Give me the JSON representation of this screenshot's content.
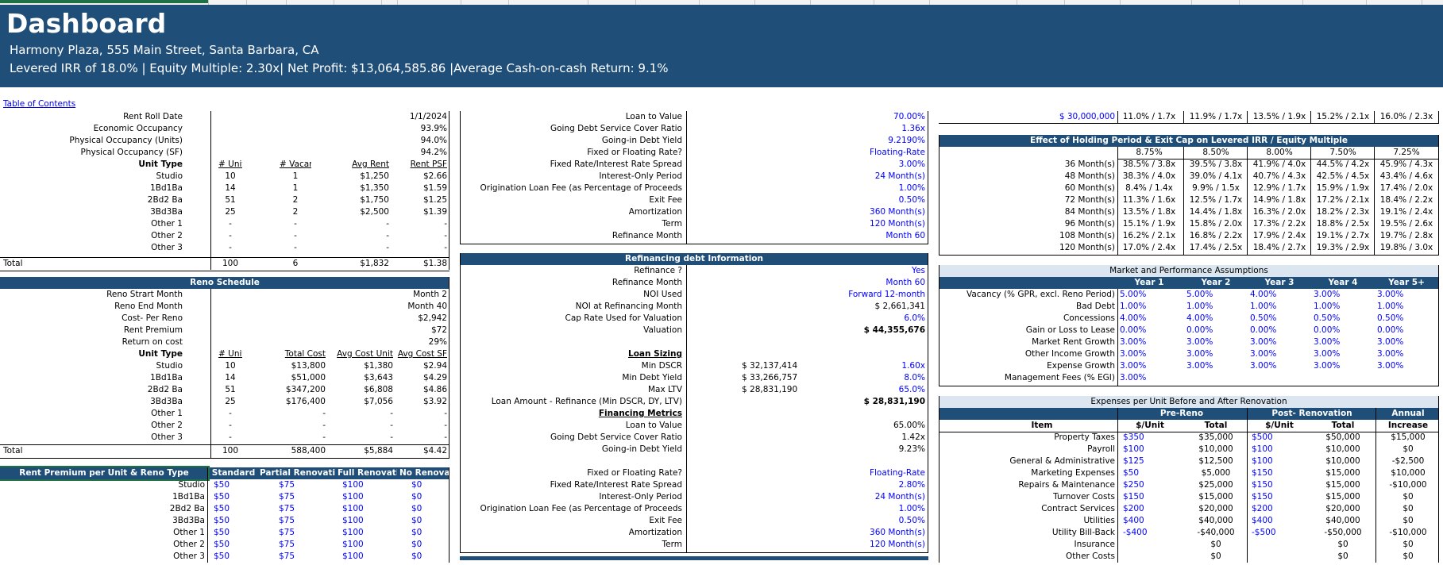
{
  "dashboard": {
    "title": "Dashboard",
    "address": "Harmony Plaza, 555 Main Street, Santa Barbara, CA",
    "summary": "Levered IRR of 18.0% | Equity Multiple: 2.30x| Net Profit: $13,064,585.86 |Average Cash-on-cash Return: 9.1%",
    "toc": "Table of Contents"
  },
  "colors": {
    "header_blue": "#1f4e79",
    "light_blue": "#dce6f1",
    "input_blue": "#0000ff"
  },
  "rent_roll": {
    "kv": [
      [
        "Rent Roll Date",
        "1/1/2024"
      ],
      [
        "Economic Occupancy",
        "93.9%"
      ],
      [
        "Physical Occupancy (Units)",
        "94.0%"
      ],
      [
        "Physical Occupancy (SF)",
        "94.2%"
      ]
    ],
    "headers": [
      "Unit Type",
      "# Units",
      "# Vacant",
      "Avg Rent",
      "Rent PSF"
    ],
    "rows": [
      [
        "Studio",
        "10",
        "1",
        "$1,250",
        "$2.66"
      ],
      [
        "1Bd1Ba",
        "14",
        "1",
        "$1,350",
        "$1.59"
      ],
      [
        "2Bd2 Ba",
        "51",
        "2",
        "$1,750",
        "$1.25"
      ],
      [
        "3Bd3Ba",
        "25",
        "2",
        "$2,500",
        "$1.39"
      ],
      [
        "Other 1",
        "-",
        "-",
        "-",
        "-"
      ],
      [
        "Other 2",
        "-",
        "-",
        "-",
        "-"
      ],
      [
        "Other 3",
        "-",
        "-",
        "-",
        "-"
      ]
    ],
    "total": [
      "Total",
      "100",
      "6",
      "$1,832",
      "$1.38"
    ]
  },
  "reno": {
    "title": "Reno Schedule",
    "kv": [
      [
        "Reno Strart Month",
        "Month 2"
      ],
      [
        "Reno End Month",
        "Month 40"
      ],
      [
        "Cost- Per Reno",
        "$2,942"
      ],
      [
        "Rent Premium",
        "$72"
      ],
      [
        "Return on cost",
        "29%"
      ]
    ],
    "headers": [
      "Unit Type",
      "# Units",
      "Total Cost",
      "Avg Cost Unit",
      "Avg Cost SF"
    ],
    "rows": [
      [
        "Studio",
        "10",
        "$13,800",
        "$1,380",
        "$2.94"
      ],
      [
        "1Bd1Ba",
        "14",
        "$51,000",
        "$3,643",
        "$4.29"
      ],
      [
        "2Bd2 Ba",
        "51",
        "$347,200",
        "$6,808",
        "$4.86"
      ],
      [
        "3Bd3Ba",
        "25",
        "$176,400",
        "$7,056",
        "$3.92"
      ],
      [
        "Other 1",
        "-",
        "-",
        "-",
        "-"
      ],
      [
        "Other 2",
        "-",
        "-",
        "-",
        "-"
      ],
      [
        "Other 3",
        "-",
        "-",
        "-",
        "-"
      ]
    ],
    "total": [
      "Total",
      "100",
      "588,400",
      "$5,884",
      "$4.42"
    ]
  },
  "premium": {
    "title": "Rent Premium per Unit & Reno Type",
    "headers": [
      "Standard",
      "Partial Renovation",
      "Full Renovation",
      "No Renovation"
    ],
    "rows": [
      [
        "Studio",
        "$50",
        "$75",
        "$100",
        "$0"
      ],
      [
        "1Bd1Ba",
        "$50",
        "$75",
        "$100",
        "$0"
      ],
      [
        "2Bd2 Ba",
        "$50",
        "$75",
        "$100",
        "$0"
      ],
      [
        "3Bd3Ba",
        "$50",
        "$75",
        "$100",
        "$0"
      ],
      [
        "Other 1",
        "$50",
        "$75",
        "$100",
        "$0"
      ],
      [
        "Other 2",
        "$50",
        "$75",
        "$100",
        "$0"
      ],
      [
        "Other 3",
        "$50",
        "$75",
        "$100",
        "$0"
      ]
    ]
  },
  "loan": {
    "rows": [
      [
        "Loan to Value",
        "70.00%"
      ],
      [
        "Going Debt Service Cover Ratio",
        "1.36x"
      ],
      [
        "Going-in Debt Yield",
        "9.2190%"
      ],
      [
        "Fixed or Floating Rate?",
        "Floating-Rate"
      ],
      [
        "Fixed Rate/Interest Rate Spread",
        "3.00%"
      ],
      [
        "Interest-Only Period",
        "24 Month(s)"
      ],
      [
        "Origination Loan Fee (as Percentage of Proceeds",
        "1.00%"
      ],
      [
        "Exit Fee",
        "0.50%"
      ],
      [
        "Amortization",
        "360 Month(s)"
      ],
      [
        "Term",
        "120 Month(s)"
      ],
      [
        "Refinance Month",
        "Month 60"
      ]
    ]
  },
  "refi": {
    "title": "Refinancing debt Information",
    "top": [
      [
        "Refinance ?",
        "Yes"
      ],
      [
        "Refinance Month",
        "Month 60"
      ],
      [
        "NOI Used",
        "Forward 12-month"
      ],
      [
        "NOI at Refinancing Month",
        "$ 2,661,341"
      ],
      [
        "Cap Rate Used for Valuation",
        "6.0%"
      ],
      [
        "Valuation",
        "$ 44,355,676"
      ]
    ],
    "sizing_title": "Loan Sizing",
    "sizing": [
      [
        "Min DSCR",
        "$ 32,137,414",
        "1.60x"
      ],
      [
        "Min Debt Yield",
        "$ 33,266,757",
        "8.0%"
      ],
      [
        "Max LTV",
        "$ 28,831,190",
        "65.0%"
      ]
    ],
    "loan_amount": [
      "Loan Amount - Refinance (Min DSCR, DY, LTV)",
      "$ 28,831,190"
    ],
    "metrics_title": "Financing Metrics",
    "metrics": [
      [
        "Loan to Value",
        "65.00%"
      ],
      [
        "Going Debt Service Cover Ratio",
        "1.42x"
      ],
      [
        "Going-in Debt Yield",
        "9.23%"
      ]
    ],
    "terms": [
      [
        "Fixed or Floating Rate?",
        "Floating-Rate"
      ],
      [
        "Fixed Rate/Interest Rate Spread",
        "2.80%"
      ],
      [
        "Interest-Only Period",
        "24 Month(s)"
      ],
      [
        "Origination Loan Fee (as Percentage of Proceeds",
        "1.00%"
      ],
      [
        "Exit Fee",
        "0.50%"
      ],
      [
        "Amortization",
        "360 Month(s)"
      ],
      [
        "Term",
        "120 Month(s)"
      ]
    ]
  },
  "sens_top": {
    "label": "$ 30,000,000",
    "values": [
      "11.0% / 1.7x",
      "11.9% / 1.7x",
      "13.5% / 1.9x",
      "15.2% / 2.1x",
      "16.0% / 2.3x"
    ]
  },
  "sens": {
    "title": "Effect of Holding Period & Exit Cap on Levered IRR / Equity Multiple",
    "caps": [
      "8.75%",
      "8.50%",
      "8.00%",
      "7.50%",
      "7.25%"
    ],
    "rows": [
      [
        "36 Month(s)",
        "38.5% / 3.8x",
        "39.5% / 3.8x",
        "41.9% / 4.0x",
        "44.5% / 4.2x",
        "45.9% / 4.3x"
      ],
      [
        "48 Month(s)",
        "38.3% / 4.0x",
        "39.0% / 4.1x",
        "40.7% / 4.3x",
        "42.5% / 4.5x",
        "43.4% / 4.6x"
      ],
      [
        "60 Month(s)",
        "8.4% / 1.4x",
        "9.9% / 1.5x",
        "12.9% / 1.7x",
        "15.9% / 1.9x",
        "17.4% / 2.0x"
      ],
      [
        "72 Month(s)",
        "11.3% / 1.6x",
        "12.5% / 1.7x",
        "14.9% / 1.8x",
        "17.2% / 2.1x",
        "18.4% / 2.2x"
      ],
      [
        "84 Month(s)",
        "13.5% / 1.8x",
        "14.4% / 1.8x",
        "16.3% / 2.0x",
        "18.2% / 2.3x",
        "19.1% / 2.4x"
      ],
      [
        "96 Month(s)",
        "15.1% / 1.9x",
        "15.8% / 2.0x",
        "17.3% / 2.2x",
        "18.8% / 2.5x",
        "19.5% / 2.6x"
      ],
      [
        "108 Month(s)",
        "16.2% / 2.1x",
        "16.8% / 2.2x",
        "17.9% / 2.4x",
        "19.1% / 2.7x",
        "19.7% / 2.8x"
      ],
      [
        "120 Month(s)",
        "17.0% / 2.4x",
        "17.4% / 2.5x",
        "18.4% / 2.7x",
        "19.3% / 2.9x",
        "19.8% / 3.0x"
      ]
    ]
  },
  "market": {
    "title": "Market and Performance Assumptions",
    "years": [
      "Year 1",
      "Year 2",
      "Year 3",
      "Year 4",
      "Year 5+"
    ],
    "rows": [
      [
        "Vacancy (% GPR, excl. Reno Period)",
        "5.00%",
        "5.00%",
        "4.00%",
        "3.00%",
        "3.00%"
      ],
      [
        "Bad Debt",
        "1.00%",
        "1.00%",
        "1.00%",
        "1.00%",
        "1.00%"
      ],
      [
        "Concessions",
        "4.00%",
        "4.00%",
        "0.50%",
        "0.50%",
        "0.50%"
      ],
      [
        "Gain or Loss to Lease",
        "0.00%",
        "0.00%",
        "0.00%",
        "0.00%",
        "0.00%"
      ],
      [
        "Market Rent Growth",
        "3.00%",
        "3.00%",
        "3.00%",
        "3.00%",
        "3.00%"
      ],
      [
        "Other Income Growth",
        "3.00%",
        "3.00%",
        "3.00%",
        "3.00%",
        "3.00%"
      ],
      [
        "Expense Growth",
        "3.00%",
        "3.00%",
        "3.00%",
        "3.00%",
        "3.00%"
      ],
      [
        "Management Fees (% EGI)",
        "3.00%",
        "",
        "",
        "",
        ""
      ]
    ]
  },
  "expenses": {
    "title": "Expenses per Unit Before and After Renovation",
    "group_pre": "Pre-Reno",
    "group_post": "Post- Renovation",
    "annual": "Annual",
    "increase": "Increase",
    "item": "Item",
    "unit": "$/Unit",
    "total": "Total",
    "rows": [
      [
        "Property Taxes",
        "$350",
        "$35,000",
        "$500",
        "$50,000",
        "$15,000"
      ],
      [
        "Payroll",
        "$100",
        "$10,000",
        "$100",
        "$10,000",
        "$0"
      ],
      [
        "General & Administrative",
        "$125",
        "$12,500",
        "$100",
        "$10,000",
        "-$2,500"
      ],
      [
        "Marketing Expenses",
        "$50",
        "$5,000",
        "$150",
        "$15,000",
        "$10,000"
      ],
      [
        "Repairs & Maintenance",
        "$250",
        "$25,000",
        "$150",
        "$15,000",
        "-$10,000"
      ],
      [
        "Turnover Costs",
        "$150",
        "$15,000",
        "$150",
        "$15,000",
        "$0"
      ],
      [
        "Contract Services",
        "$200",
        "$20,000",
        "$200",
        "$20,000",
        "$0"
      ],
      [
        "Utilities",
        "$400",
        "$40,000",
        "$400",
        "$40,000",
        "$0"
      ],
      [
        "Utility Bill-Back",
        "-$400",
        "-$40,000",
        "-$500",
        "-$50,000",
        "-$10,000"
      ],
      [
        "Insurance",
        "",
        "$0",
        "",
        "$0",
        "$0"
      ],
      [
        "Other Costs",
        "",
        "$0",
        "",
        "$0",
        "$0"
      ]
    ]
  }
}
